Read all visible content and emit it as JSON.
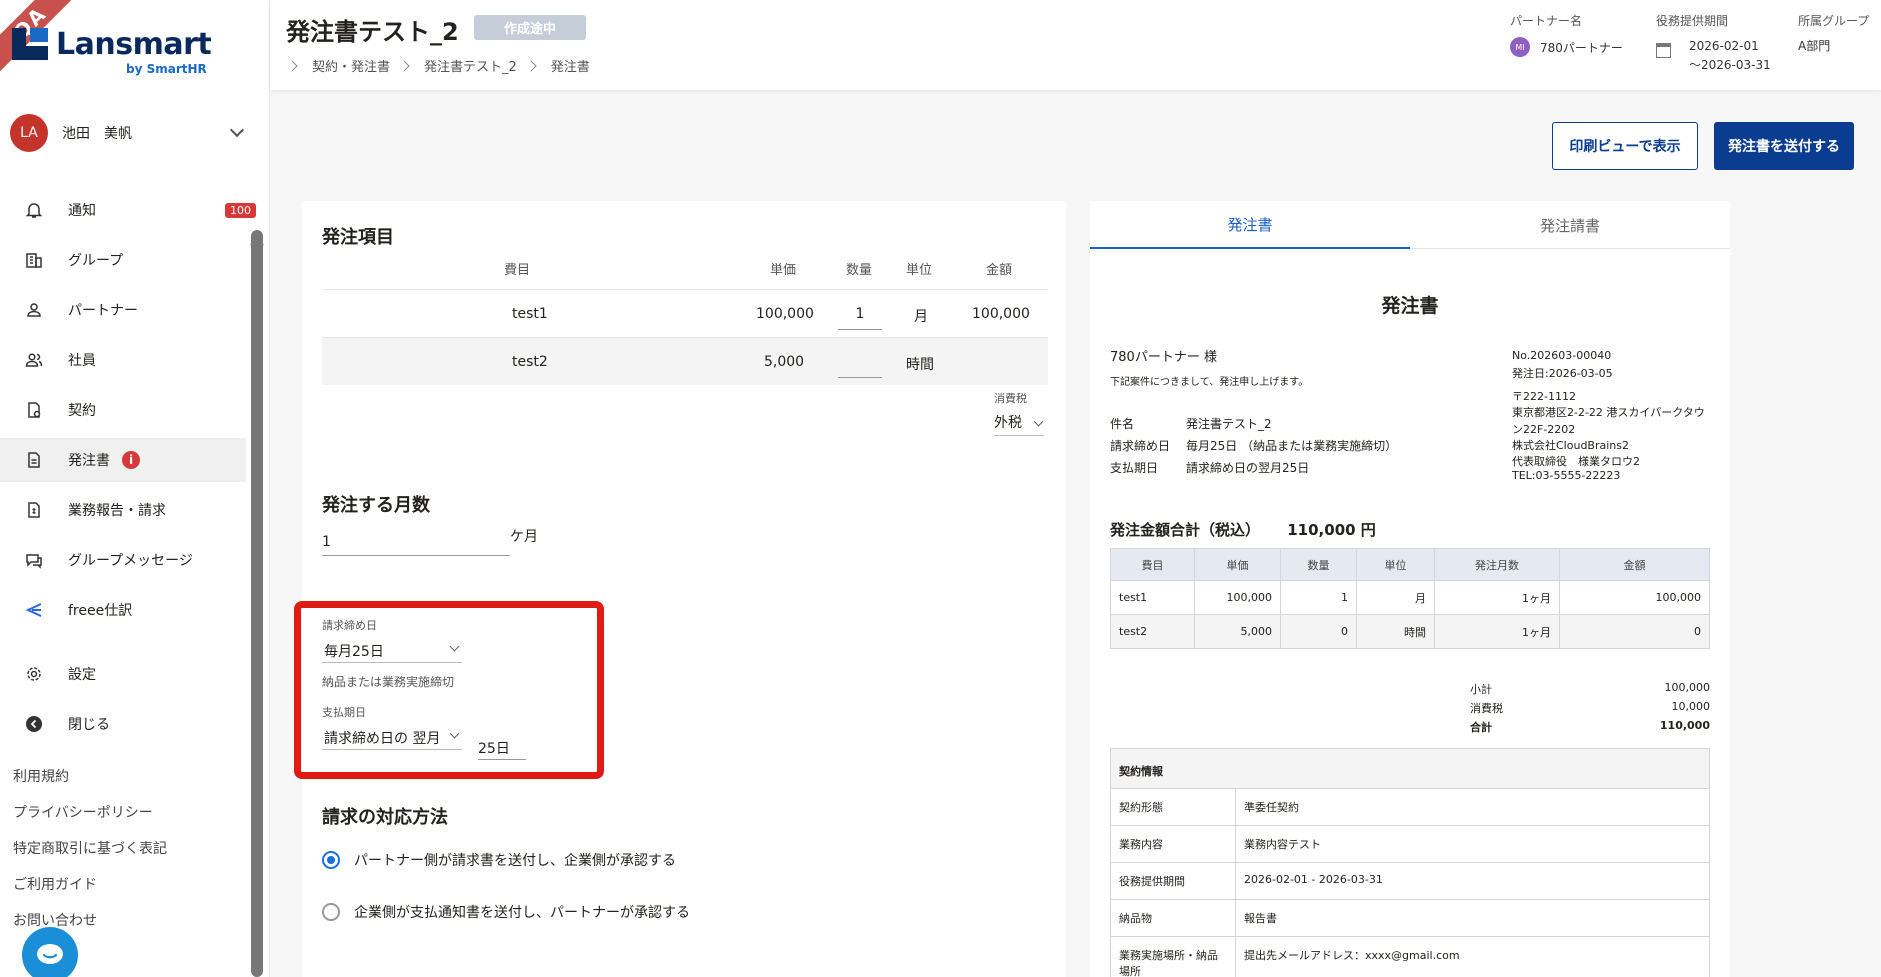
{
  "qa_badge": "QA",
  "brand": {
    "name": "Lansmart",
    "sub": "by SmartHR"
  },
  "user": {
    "initials": "LA",
    "name": "池田　美帆"
  },
  "nav": [
    {
      "label": "通知",
      "badge": "100"
    },
    {
      "label": "グループ"
    },
    {
      "label": "パートナー"
    },
    {
      "label": "社員"
    },
    {
      "label": "契約"
    },
    {
      "label": "発注書",
      "alert": "i"
    },
    {
      "label": "業務報告・請求"
    },
    {
      "label": "グループメッセージ"
    },
    {
      "label": "freee仕訳"
    },
    {
      "label": "設定"
    },
    {
      "label": "閉じる"
    }
  ],
  "footer_links": [
    "利用規約",
    "プライバシーポリシー",
    "特定商取引に基づく表記",
    "ご利用ガイド",
    "お問い合わせ"
  ],
  "header": {
    "title": "発注書テスト_2",
    "status": "作成途中",
    "breadcrumb": [
      "契約・発注書",
      "発注書テスト_2",
      "発注書"
    ],
    "partner_label": "パートナー名",
    "partner_initials": "MI",
    "partner_name": "780パートナー",
    "period_label": "役務提供期間",
    "period_start": "2026-02-01",
    "period_end": "〜2026-03-31",
    "group_label": "所属グループ",
    "group_value": "A部門"
  },
  "actions": {
    "print": "印刷ビューで表示",
    "send": "発注書を送付する"
  },
  "order_items": {
    "title": "発注項目",
    "columns": [
      "費目",
      "単価",
      "数量",
      "単位",
      "金額"
    ],
    "rows": [
      {
        "name": "test1",
        "price": "100,000",
        "qty": "1",
        "unit": "月",
        "amount": "100,000"
      },
      {
        "name": "test2",
        "price": "5,000",
        "qty": "",
        "unit": "時間",
        "amount": ""
      }
    ],
    "tax_label": "消費税",
    "tax_value": "外税"
  },
  "months": {
    "title": "発注する月数",
    "value": "1",
    "unit": "ケ月"
  },
  "billing": {
    "close_label": "請求締め日",
    "close_value": "毎月25日",
    "close_help": "納品または業務実施締切",
    "pay_label": "支払期日",
    "pay_value": "請求締め日の 翌月",
    "pay_day": "25日"
  },
  "billing_method": {
    "title": "請求の対応方法",
    "options": [
      "パートナー側が請求書を送付し、企業側が承認する",
      "企業側が支払通知書を送付し、パートナーが承認する"
    ]
  },
  "tabs": [
    "発注書",
    "発注請書"
  ],
  "doc": {
    "title": "発注書",
    "recipient": "780パートナー 様",
    "greeting": "下記案件につきまして、発注申し上げます。",
    "no": "No.202603-00040",
    "date": "発注日:2026-03-05",
    "address": [
      "〒222-1112",
      "東京都港区2-2-22 港スカイパークタウ",
      "ン22F-2202",
      "株式会社CloudBrains2",
      "代表取締役　様業タロウ2",
      "TEL:03-5555-22223"
    ],
    "fields": [
      {
        "label": "件名",
        "value": "発注書テスト_2"
      },
      {
        "label": "請求締め日",
        "value": "毎月25日 （納品または業務実施締切）"
      },
      {
        "label": "支払期日",
        "value": "請求締め日の翌月25日"
      }
    ],
    "total_label": "発注金額合計（税込）",
    "total_value": "110,000 円",
    "table_cols": [
      "費目",
      "単価",
      "数量",
      "単位",
      "発注月数",
      "金額"
    ],
    "table_rows": [
      [
        "test1",
        "100,000",
        "1",
        "月",
        "1ヶ月",
        "100,000"
      ],
      [
        "test2",
        "5,000",
        "0",
        "時間",
        "1ヶ月",
        "0"
      ]
    ],
    "sums": [
      {
        "label": "小計",
        "value": "100,000"
      },
      {
        "label": "消費税",
        "value": "10,000"
      },
      {
        "label": "合計",
        "value": "110,000"
      }
    ],
    "contract_title": "契約情報",
    "contract": [
      {
        "label": "契約形態",
        "value": "準委任契約"
      },
      {
        "label": "業務内容",
        "value": "業務内容テスト"
      },
      {
        "label": "役務提供期間",
        "value": "2026-02-01 - 2026-03-31"
      },
      {
        "label": "納品物",
        "value": "報告書"
      },
      {
        "label": "業務実施場所・納品場所",
        "value": "提出先メールアドレス：xxxx@gmail.com"
      }
    ]
  }
}
